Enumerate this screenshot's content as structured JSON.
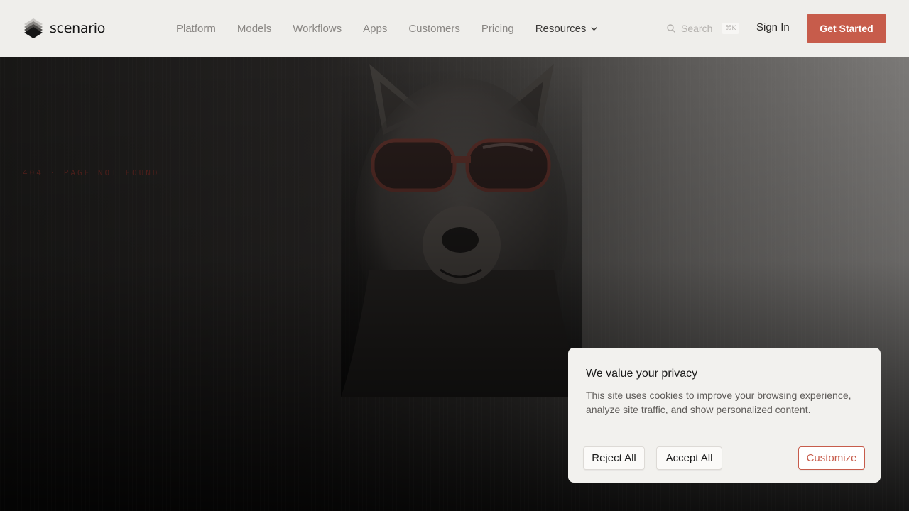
{
  "brand": {
    "name": "scenario"
  },
  "nav": {
    "items": [
      {
        "label": "Platform"
      },
      {
        "label": "Models"
      },
      {
        "label": "Workflows"
      },
      {
        "label": "Apps"
      },
      {
        "label": "Customers"
      },
      {
        "label": "Pricing"
      },
      {
        "label": "Resources"
      }
    ]
  },
  "search": {
    "placeholder": "Search",
    "shortcut": "⌘K"
  },
  "header": {
    "signin_label": "Sign In",
    "cta_label": "Get Started"
  },
  "hero": {
    "error_label": "404 · PAGE NOT FOUND"
  },
  "cookie": {
    "title": "We value your privacy",
    "body": "This site uses cookies to improve your browsing experience, analyze site traffic, and show personalized content.",
    "reject_label": "Reject All",
    "accept_label": "Accept All",
    "customize_label": "Customize"
  },
  "colors": {
    "header_bg": "#efeeeb",
    "accent": "#c75c4b",
    "banner_bg": "#f2f1ee"
  },
  "icons": {
    "logo": "layered-diamond-logo",
    "search": "search-icon",
    "resources_dropdown": "chevron-down-icon"
  }
}
